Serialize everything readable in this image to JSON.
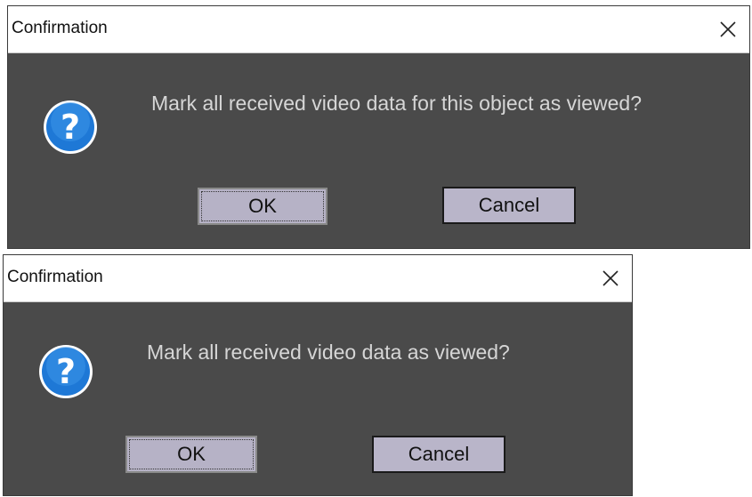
{
  "dialogs": [
    {
      "title": "Confirmation",
      "message": "Mark all received video data for this object as viewed?",
      "ok_label": "OK",
      "cancel_label": "Cancel",
      "icon": "question-icon",
      "close_icon": "close-icon"
    },
    {
      "title": "Confirmation",
      "message": "Mark all received video data as viewed?",
      "ok_label": "OK",
      "cancel_label": "Cancel",
      "icon": "question-icon",
      "close_icon": "close-icon"
    }
  ],
  "colors": {
    "dialog_background": "#4a4a4a",
    "titlebar_background": "#ffffff",
    "message_text": "#d6d6d6",
    "button_face": "#b8b4c8",
    "icon_blue": "#1e78d6"
  }
}
